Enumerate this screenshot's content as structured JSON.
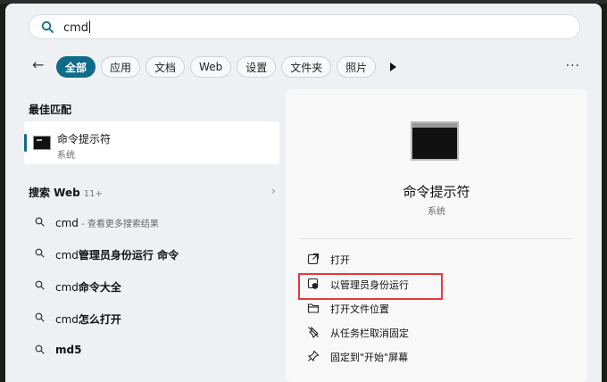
{
  "search": {
    "query": "cmd"
  },
  "filters": {
    "back": "←",
    "chips": [
      "全部",
      "应用",
      "文档",
      "Web",
      "设置",
      "文件夹",
      "照片"
    ],
    "more": "···"
  },
  "left": {
    "best_match_heading": "最佳匹配",
    "best": {
      "title": "命令提示符",
      "subtitle": "系统"
    },
    "web_heading": "搜索 Web",
    "web_count": "11+",
    "web_arrow": "›",
    "results": [
      {
        "prefix": "cmd",
        "bold": "",
        "suffix": " - 查看更多搜索结果"
      },
      {
        "prefix": "cmd",
        "bold": "管理员身份运行 命令",
        "suffix": ""
      },
      {
        "prefix": "cmd",
        "bold": "命令大全",
        "suffix": ""
      },
      {
        "prefix": "cmd",
        "bold": "怎么打开",
        "suffix": ""
      },
      {
        "prefix": "",
        "bold": "md5",
        "suffix": ""
      }
    ]
  },
  "right": {
    "title": "命令提示符",
    "subtitle": "系统",
    "actions": [
      {
        "icon": "open-external-icon",
        "label": "打开"
      },
      {
        "icon": "shield-admin-icon",
        "label": "以管理员身份运行"
      },
      {
        "icon": "folder-icon",
        "label": "打开文件位置"
      },
      {
        "icon": "unpin-icon",
        "label": "从任务栏取消固定"
      },
      {
        "icon": "pin-icon",
        "label": "固定到\"开始\"屏幕"
      }
    ]
  },
  "colors": {
    "accent": "#0f6b8a",
    "highlight_border": "#e5393b"
  }
}
